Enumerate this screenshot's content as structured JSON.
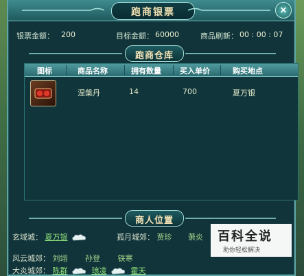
{
  "window": {
    "title": "跑商银票",
    "close_label": "×"
  },
  "status": {
    "silver_label": "银票金额：",
    "silver_value": "200",
    "target_label": "目标金额：",
    "target_value": "60000",
    "refresh_label": "商品刷新：",
    "refresh_value": "00 : 00 : 07"
  },
  "warehouse": {
    "title": "跑商仓库",
    "columns": [
      "图标",
      "商品名称",
      "拥有数量",
      "买入单价",
      "购买地点"
    ],
    "rows": [
      {
        "icon": "item-icon",
        "name": "涅槃丹",
        "quantity": "14",
        "unit_price": "700",
        "location": "夏万银"
      }
    ]
  },
  "merchants": {
    "title": "商人位置",
    "rows": [
      {
        "city": "玄域城：",
        "people": [
          {
            "name": "夏万银",
            "link": true,
            "cloud": true
          }
        ]
      },
      {
        "city": "孤月城郊：",
        "people": [
          {
            "name": "贾珍",
            "link": false,
            "cloud": false
          },
          {
            "name": "萧炎",
            "link": false,
            "cloud": false
          }
        ]
      },
      {
        "city": "风云城郊：",
        "people": [
          {
            "name": "刘翊",
            "link": false,
            "cloud": false
          },
          {
            "name": "孙登",
            "link": false,
            "cloud": false
          },
          {
            "name": "铁寒",
            "link": false,
            "cloud": false
          }
        ]
      },
      {
        "city": "大炎城郊：",
        "people": [
          {
            "name": "陈群",
            "link": true,
            "cloud": true
          },
          {
            "name": "琅凌",
            "link": true,
            "cloud": true
          },
          {
            "name": "霍天",
            "link": true,
            "cloud": false
          }
        ]
      }
    ]
  },
  "watermark": {
    "title": "百科全说",
    "subtitle": "助你轻松解决"
  },
  "colors": {
    "accent": "#5fa6a6",
    "text_gold": "#f6e4b8",
    "link_green": "#8fe07a"
  }
}
